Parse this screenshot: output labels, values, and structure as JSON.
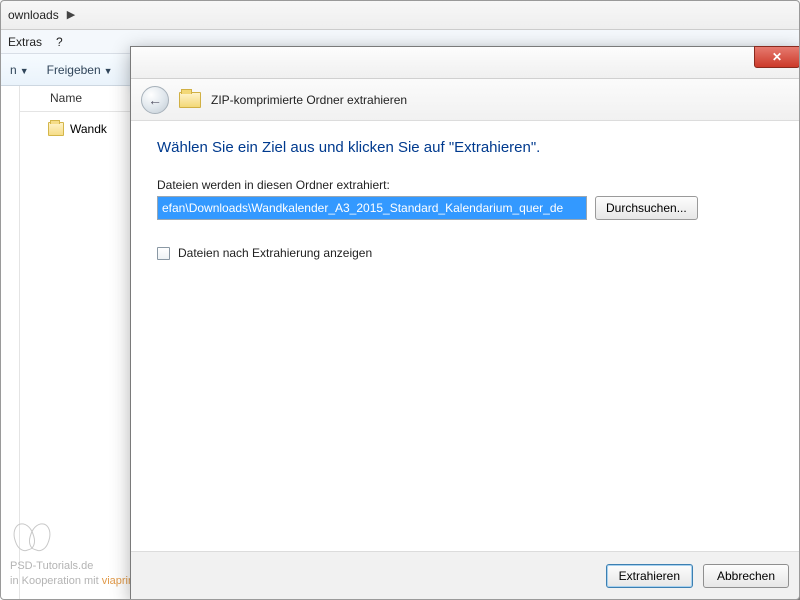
{
  "explorer": {
    "breadcrumb": "ownloads",
    "menu": {
      "extras": "Extras",
      "help": "?"
    },
    "toolbar": {
      "organize": "n",
      "share": "Freigeben"
    },
    "column_header": "Name",
    "file_item": "Wandk"
  },
  "dialog": {
    "header_title": "ZIP-komprimierte Ordner extrahieren",
    "heading": "Wählen Sie ein Ziel aus und klicken Sie auf \"Extrahieren\".",
    "field_label": "Dateien werden in diesen Ordner extrahiert:",
    "path_value": "efan\\Downloads\\Wandkalender_A3_2015_Standard_Kalendarium_quer_de",
    "browse": "Durchsuchen...",
    "show_files": "Dateien nach Extrahierung anzeigen",
    "extract": "Extrahieren",
    "cancel": "Abbrechen",
    "close_glyph": "✕"
  },
  "watermark": {
    "line1": "PSD-Tutorials.de",
    "line2_a": "in Kooperation mit ",
    "line2_b": "viaprinto"
  }
}
